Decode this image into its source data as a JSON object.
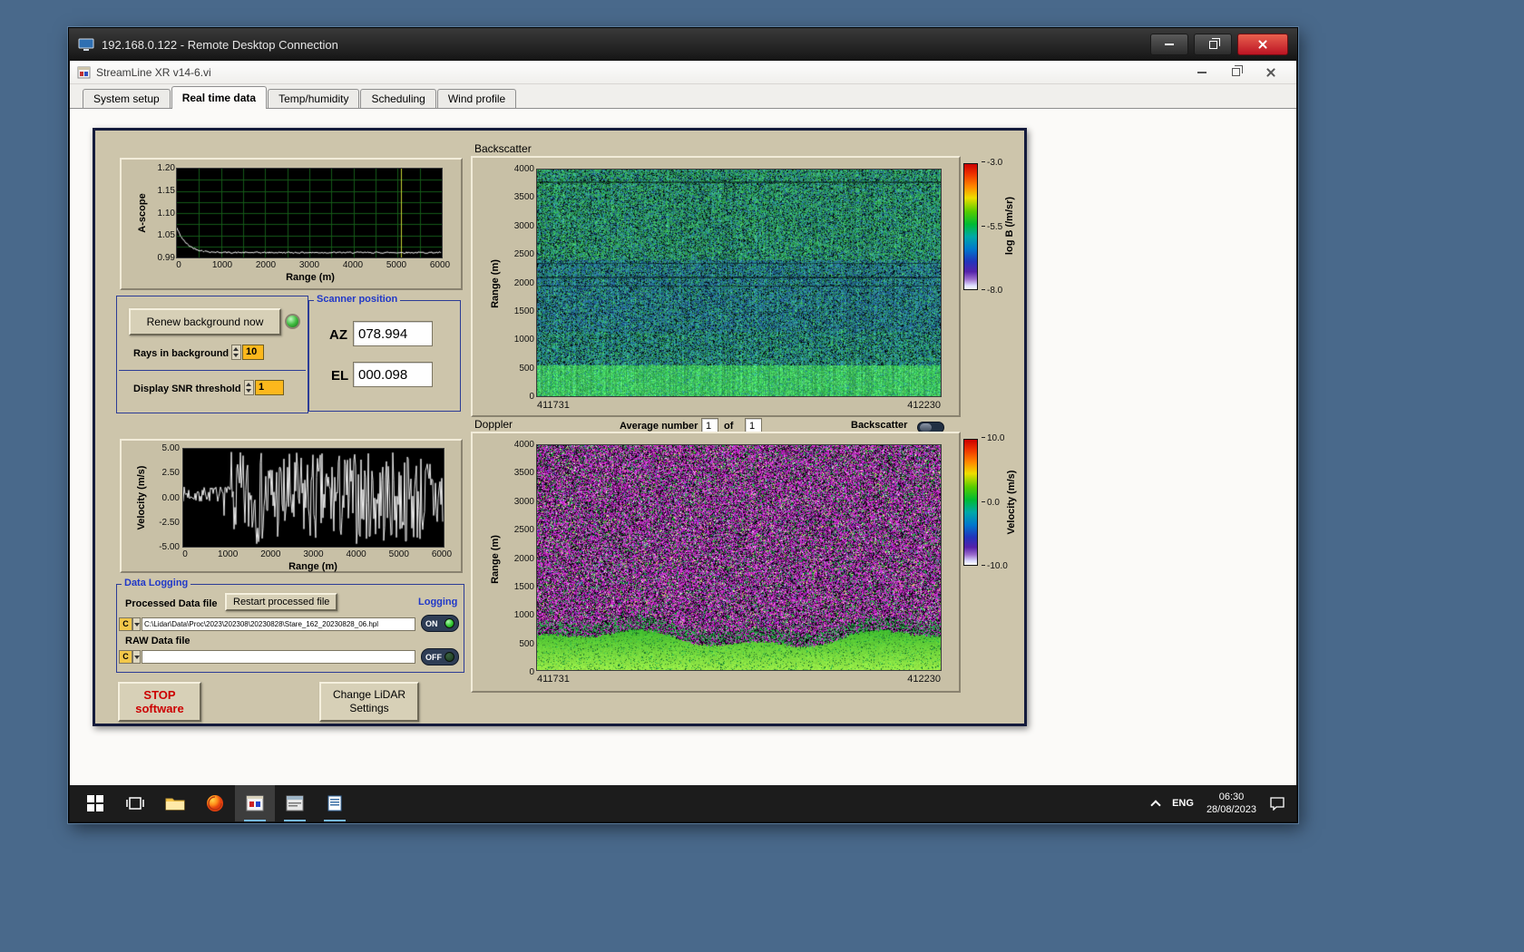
{
  "colors": {
    "desktop": "#49698b",
    "panel": "#cdc5ab",
    "group_title_blue": "#2038c8",
    "amber_value": "#fcb81c",
    "taskbar": "#1c1c1c",
    "close_button_red": "#bc1423"
  },
  "rdp": {
    "title": "192.168.0.122 - Remote Desktop Connection"
  },
  "app": {
    "title": "StreamLine XR v14-6.vi",
    "tabs": [
      "System setup",
      "Real time data",
      "Temp/humidity",
      "Scheduling",
      "Wind profile"
    ],
    "active_tab": "Real time data"
  },
  "ascope": {
    "ylabel": "A-scope",
    "yticks": [
      "1.20",
      "1.15",
      "1.10",
      "1.05",
      "0.99"
    ],
    "xticks": [
      "0",
      "1000",
      "2000",
      "3000",
      "4000",
      "5000",
      "6000"
    ],
    "xlabel": "Range (m)"
  },
  "background_controls": {
    "renew_button": "Renew background now",
    "rays_label": "Rays in background",
    "rays_value": "10",
    "snr_label": "Display SNR threshold",
    "snr_value": "1"
  },
  "scanner": {
    "title": "Scanner position",
    "az_label": "AZ",
    "az_value": "078.994",
    "el_label": "EL",
    "el_value": "000.098"
  },
  "velocity_plot": {
    "ylabel": "Velocity (m/s)",
    "yticks": [
      "5.00",
      "2.50",
      "0.00",
      "-2.50",
      "-5.00"
    ],
    "xticks": [
      "0",
      "1000",
      "2000",
      "3000",
      "4000",
      "5000",
      "6000"
    ],
    "xlabel": "Range (m)"
  },
  "data_logging": {
    "title": "Data Logging",
    "processed_label": "Processed Data file",
    "restart_button": "Restart processed file",
    "logging_label": "Logging",
    "drive": "C",
    "processed_path": "C:\\Lidar\\Data\\Proc\\2023\\202308\\20230828\\Stare_162_20230828_06.hpl",
    "processed_state": "ON",
    "raw_label": "RAW Data file",
    "raw_path": "",
    "raw_state": "OFF"
  },
  "actions": {
    "stop_line1": "STOP",
    "stop_line2": "software",
    "change_line1": "Change LiDAR",
    "change_line2": "Settings"
  },
  "backscatter": {
    "title": "Backscatter",
    "ylabel": "Range (m)",
    "yticks": [
      "4000",
      "3500",
      "3000",
      "2500",
      "2000",
      "1500",
      "1000",
      "500",
      "0"
    ],
    "x_left": "411731",
    "x_right": "412230",
    "cb_ticks": [
      "-3.0",
      "-5.5",
      "-8.0"
    ],
    "cb_label": "log B (/m/sr)"
  },
  "doppler": {
    "title": "Doppler",
    "avg_label": "Average number",
    "avg_n": "1",
    "of_label": "of",
    "avg_m": "1",
    "toggle_label": "Backscatter",
    "ylabel": "Range (m)",
    "yticks": [
      "4000",
      "3500",
      "3000",
      "2500",
      "2000",
      "1500",
      "1000",
      "500",
      "0"
    ],
    "x_left": "411731",
    "x_right": "412230",
    "cb_ticks": [
      "10.0",
      "0.0",
      "-10.0"
    ],
    "cb_label": "Velocity (m/s)"
  },
  "taskbar": {
    "lang": "ENG",
    "time": "06:30",
    "date": "28/08/2023"
  }
}
